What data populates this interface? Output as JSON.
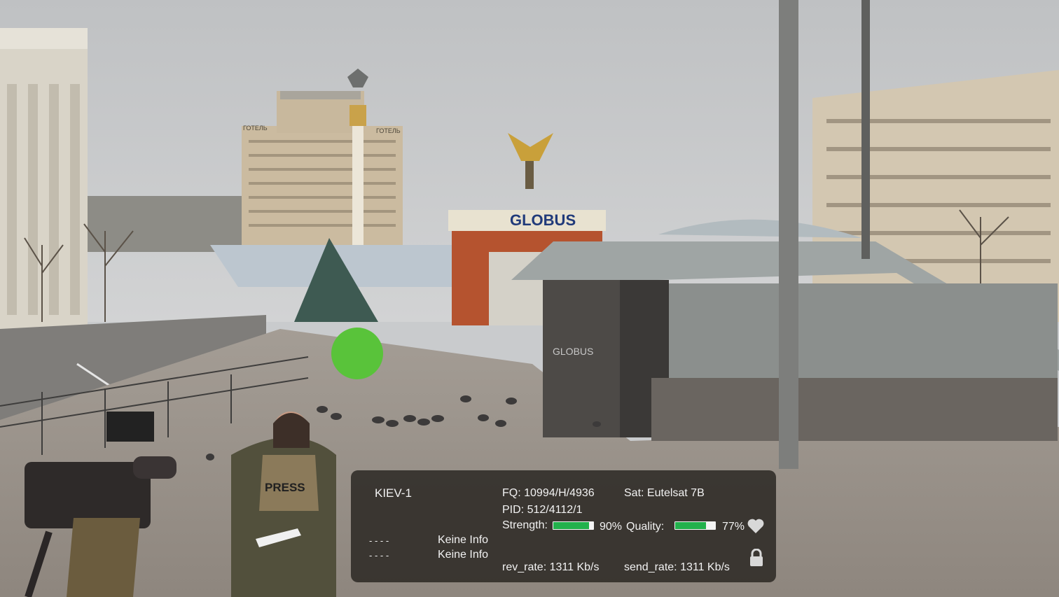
{
  "channel": {
    "name": "KIEV-1",
    "fq_label": "FQ:",
    "fq_value": "10994/H/4936",
    "sat_label": "Sat:",
    "sat_value": "Eutelsat 7B",
    "pid_label": "PID:",
    "pid_value": "512/4112/1",
    "strength_label": "Strength:",
    "strength_percent": 90,
    "strength_text": "90%",
    "quality_label": "Quality:",
    "quality_percent": 77,
    "quality_text": "77%",
    "epg": [
      {
        "time": "- - - -",
        "title": "Keine Info"
      },
      {
        "time": "- - - -",
        "title": "Keine Info"
      }
    ],
    "rev_rate_label": "rev_rate:",
    "rev_rate_value": "1311 Kb/s",
    "send_rate_label": "send_rate:",
    "send_rate_value": "1311 Kb/s"
  },
  "icons": {
    "favorite": "heart-icon",
    "lock": "lock-icon",
    "menu": "menu-icon"
  },
  "colors": {
    "signal_bar": "#22b14c",
    "panel_bg": "#2d2a26"
  },
  "scene_signage": {
    "hotel_left": "ГОТЕЛЬ",
    "hotel_right": "ГОТЕЛЬ",
    "globus": "GLOBUS",
    "press": "PRESS",
    "door_sign": "GLOBUS"
  }
}
